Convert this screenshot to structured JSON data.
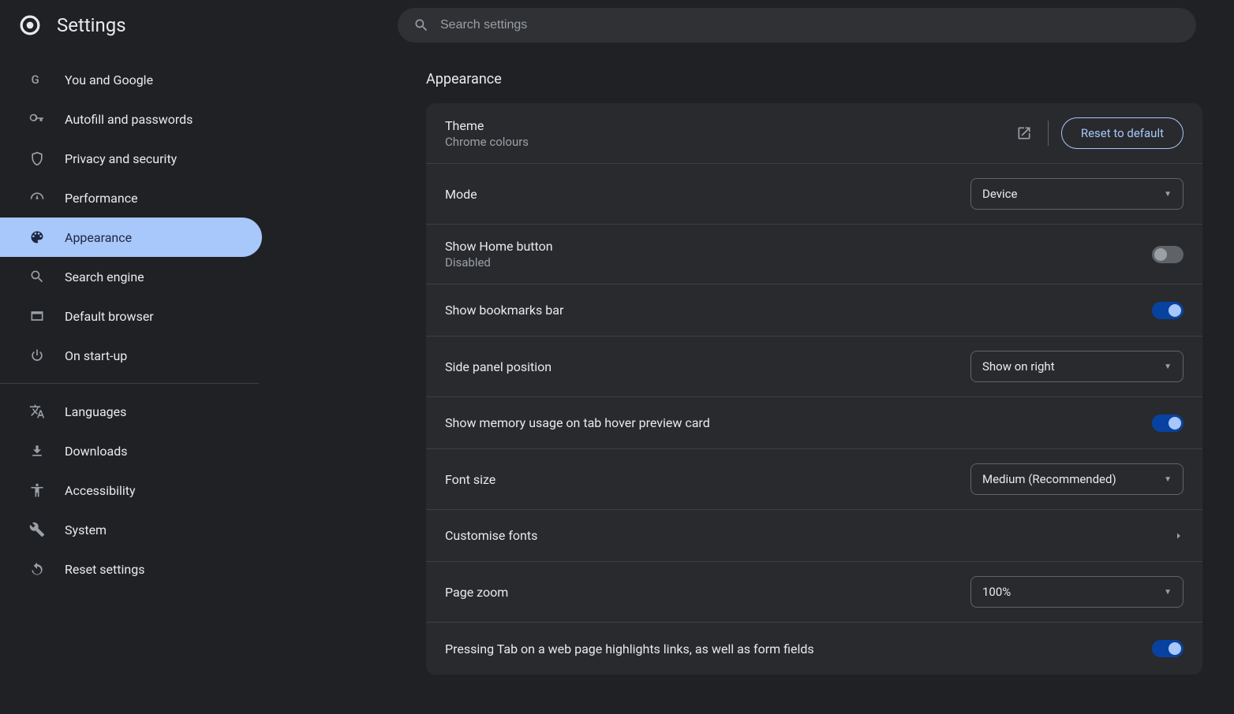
{
  "header": {
    "title": "Settings",
    "search_placeholder": "Search settings"
  },
  "sidebar": {
    "items": [
      {
        "label": "You and Google",
        "icon": "google-icon"
      },
      {
        "label": "Autofill and passwords",
        "icon": "key-icon"
      },
      {
        "label": "Privacy and security",
        "icon": "shield-icon"
      },
      {
        "label": "Performance",
        "icon": "speedometer-icon"
      },
      {
        "label": "Appearance",
        "icon": "palette-icon",
        "active": true
      },
      {
        "label": "Search engine",
        "icon": "search-icon"
      },
      {
        "label": "Default browser",
        "icon": "browser-icon"
      },
      {
        "label": "On start-up",
        "icon": "power-icon"
      }
    ],
    "items2": [
      {
        "label": "Languages",
        "icon": "translate-icon"
      },
      {
        "label": "Downloads",
        "icon": "download-icon"
      },
      {
        "label": "Accessibility",
        "icon": "accessibility-icon"
      },
      {
        "label": "System",
        "icon": "wrench-icon"
      },
      {
        "label": "Reset settings",
        "icon": "reset-icon"
      }
    ]
  },
  "section": {
    "title": "Appearance"
  },
  "rows": {
    "theme": {
      "title": "Theme",
      "subtitle": "Chrome colours",
      "button": "Reset to default"
    },
    "mode": {
      "title": "Mode",
      "value": "Device"
    },
    "home": {
      "title": "Show Home button",
      "subtitle": "Disabled",
      "on": false
    },
    "bookmarks": {
      "title": "Show bookmarks bar",
      "on": true
    },
    "sidepanel": {
      "title": "Side panel position",
      "value": "Show on right"
    },
    "memory": {
      "title": "Show memory usage on tab hover preview card",
      "on": true
    },
    "fontsize": {
      "title": "Font size",
      "value": "Medium (Recommended)"
    },
    "customfonts": {
      "title": "Customise fonts"
    },
    "zoom": {
      "title": "Page zoom",
      "value": "100%"
    },
    "tab": {
      "title": "Pressing Tab on a web page highlights links, as well as form fields",
      "on": true
    }
  }
}
